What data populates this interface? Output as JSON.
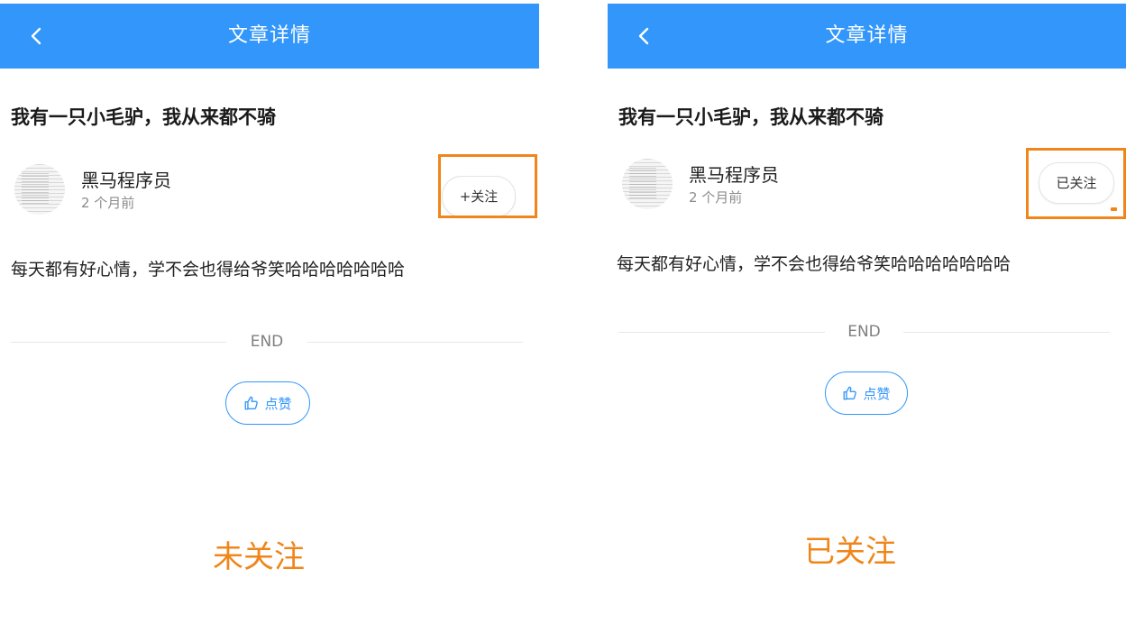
{
  "left": {
    "nav_title": "文章详情",
    "article_title": "我有一只小毛驴，我从来都不骑",
    "author_name": "黑马程序员",
    "pub_time": "2 个月前",
    "follow_label": "+关注",
    "content": "每天都有好心情，学不会也得给爷笑哈哈哈哈哈哈哈",
    "end_label": "END",
    "like_label": "点赞",
    "caption": "未关注"
  },
  "right": {
    "nav_title": "文章详情",
    "article_title": "我有一只小毛驴，我从来都不骑",
    "author_name": "黑马程序员",
    "pub_time": "2 个月前",
    "follow_label": "已关注",
    "content": "每天都有好心情，学不会也得给爷笑哈哈哈哈哈哈哈",
    "end_label": "END",
    "like_label": "点赞",
    "caption": "已关注"
  },
  "colors": {
    "nav_bar": "#3296fa",
    "accent_blue": "#3296fa",
    "highlight_orange": "#f08519"
  },
  "icons": {
    "back": "chevron-left-icon",
    "like": "thumbs-up-icon"
  }
}
